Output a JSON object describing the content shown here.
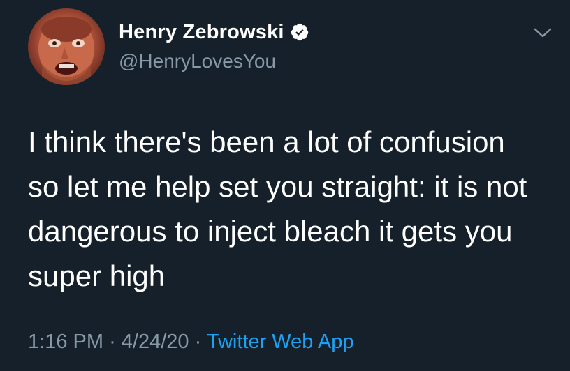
{
  "tweet": {
    "author": {
      "display_name": "Henry Zebrowski",
      "handle": "@HenryLovesYou",
      "verified_icon": "verified-badge-icon",
      "avatar": "avatar-photo"
    },
    "menu_icon": "chevron-down-icon",
    "text": "I think there's been a lot of confusion\nso let me help set you straight: it is not\ndangerous to inject bleach it gets you\nsuper high",
    "meta": {
      "time": "1:16 PM",
      "separator": "·",
      "date": "4/24/20",
      "source": "Twitter Web App"
    }
  },
  "colors": {
    "background": "#15202b",
    "primary_text": "#ffffff",
    "secondary_text": "#8899a6",
    "accent": "#1da1f2"
  }
}
